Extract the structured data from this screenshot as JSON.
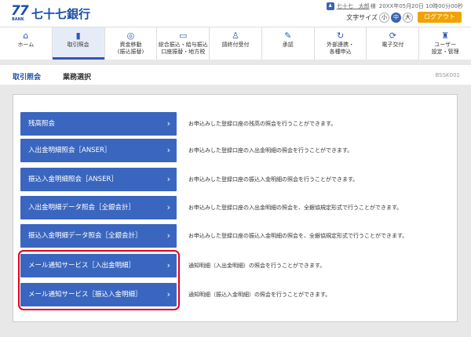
{
  "header": {
    "logo_mark": "77",
    "logo_sub": "BANK",
    "bank_name": "七十七銀行",
    "user_icon": "",
    "user_name": "七十七　太郎",
    "user_suffix": "様",
    "timestamp": "20XX年05月20日 10時00分00秒",
    "font_size_label": "文字サイズ",
    "font_sizes": [
      "小",
      "中",
      "大"
    ],
    "logout_label": "ログアウト"
  },
  "nav": [
    {
      "icon": "home-icon",
      "label": "ホーム"
    },
    {
      "icon": "document-icon",
      "label": "取引照会"
    },
    {
      "icon": "transfer-icon",
      "label": "資金移動\n(振込振替)"
    },
    {
      "icon": "payment-icon",
      "label": "総合振込・給与振込\n口座振替・地方税"
    },
    {
      "icon": "user-check-icon",
      "label": "請終付受付"
    },
    {
      "icon": "approval-icon",
      "label": "承認"
    },
    {
      "icon": "cycle-icon",
      "label": "外部連携・\n各種申込"
    },
    {
      "icon": "exchange-icon",
      "label": "電子交付"
    },
    {
      "icon": "admin-icon",
      "label": "ユーザー\n設定・管理"
    }
  ],
  "titlebar": {
    "main": "取引照会",
    "sub": "業務選択",
    "code": "BSSK001"
  },
  "menu": [
    {
      "label": "残高照会",
      "desc": "お申込みした登録口座の残高の照会を行うことができます。"
    },
    {
      "label": "入出金明細照会［ANSER］",
      "desc": "お申込みした登録口座の入出金明細の照会を行うことができます。"
    },
    {
      "label": "振込入金明細照会［ANSER］",
      "desc": "お申込みした登録口座の振込入金明細の照会を行うことができます。"
    },
    {
      "label": "入出金明細データ照会［全銀会計］",
      "desc": "お申込みした登録口座の入出金明細の照会を、全銀協規定形式で行うことができます。"
    },
    {
      "label": "振込入金明細データ照会［全銀会計］",
      "desc": "お申込みした登録口座の振込入金明細の照会を、全銀協規定形式で行うことができます。"
    },
    {
      "label": "メール通知サービス［入出金明細］",
      "desc": "通知明細（入出金明細）の照会を行うことができます。"
    },
    {
      "label": "メール通知サービス［振込入金明細］",
      "desc": "通知明細（振込入金明細）の照会を行うことができます。"
    }
  ],
  "chevron": "›",
  "colors": {
    "accent": "#3a66bf",
    "logout": "#f1a200",
    "highlight": "#e3001b"
  }
}
